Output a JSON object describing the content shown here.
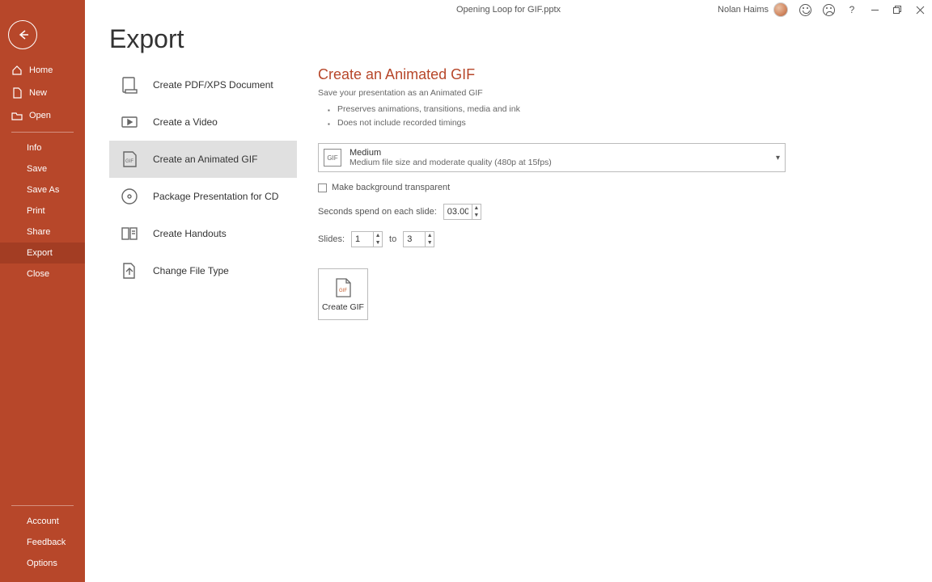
{
  "titlebar": {
    "doc_title": "Opening Loop for GIF.pptx",
    "user_name": "Nolan Haims"
  },
  "sidebar": {
    "home": "Home",
    "new": "New",
    "open": "Open",
    "info": "Info",
    "save": "Save",
    "save_as": "Save As",
    "print": "Print",
    "share": "Share",
    "export": "Export",
    "close": "Close",
    "account": "Account",
    "feedback": "Feedback",
    "options": "Options"
  },
  "page_title": "Export",
  "export_options": {
    "pdf": "Create PDF/XPS Document",
    "video": "Create a Video",
    "gif": "Create an Animated GIF",
    "cd": "Package Presentation for CD",
    "handouts": "Create Handouts",
    "filetype": "Change File Type"
  },
  "detail": {
    "heading": "Create an Animated GIF",
    "subtitle": "Save your presentation as an Animated GIF",
    "bullet1": "Preserves animations, transitions, media and ink",
    "bullet2": "Does not include recorded timings",
    "quality": {
      "label": "Medium",
      "desc": "Medium file size and moderate quality (480p at 15fps)"
    },
    "transparent_label": "Make background transparent",
    "seconds_label": "Seconds spend on each slide:",
    "seconds_value": "03.00",
    "slides_label": "Slides:",
    "slides_from": "1",
    "slides_to_label": "to",
    "slides_to": "3",
    "create_button": "Create GIF"
  }
}
